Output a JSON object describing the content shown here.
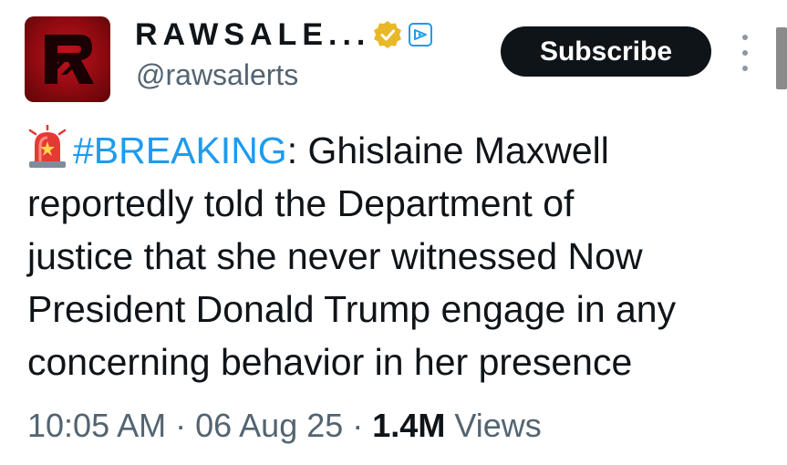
{
  "author": {
    "display_name": "RAWSALE...",
    "handle": "@rawsalerts",
    "avatar_icon": "rawsalerts-logo",
    "verified_icon": "verified-gold-badge",
    "affiliate_icon": "affiliate-badge-icon"
  },
  "actions": {
    "subscribe_label": "Subscribe",
    "more_icon": "more-vertical-icon"
  },
  "tweet": {
    "siren_icon": "police-siren-emoji",
    "hashtag": "#BREAKING",
    "line1_rest": ": Ghislaine Maxwell",
    "line2": "reportedly told the Department of",
    "line3": "justice that she never witnessed Now",
    "line4": "President Donald Trump engage in any",
    "line5": "concerning behavior in her presence"
  },
  "meta": {
    "time": "10:05 AM",
    "separator": " · ",
    "date": "06 Aug 25",
    "views_count": "1.4M",
    "views_label": " Views"
  },
  "colors": {
    "text": "#0f1419",
    "secondary": "#536471",
    "link": "#1d9bf0",
    "verified_gold": "#e8b829",
    "avatar_red": "#c4121c",
    "button_bg": "#0f1419"
  }
}
